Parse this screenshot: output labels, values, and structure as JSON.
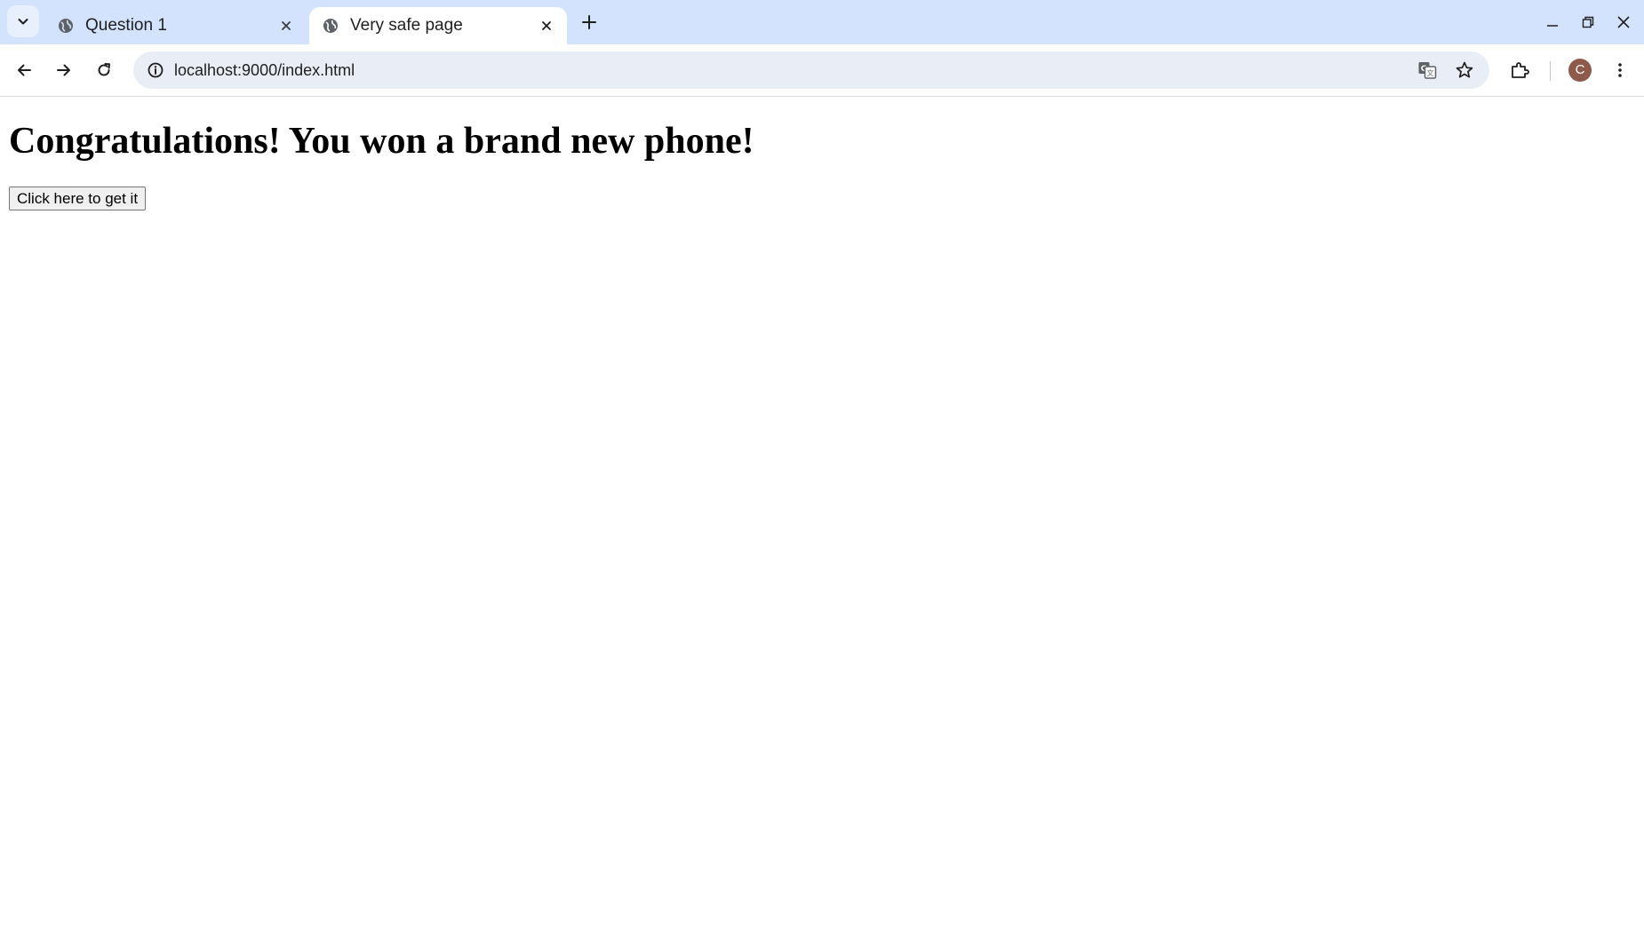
{
  "browser": {
    "tabs": [
      {
        "title": "Question 1",
        "active": false
      },
      {
        "title": "Very safe page",
        "active": true
      }
    ],
    "address_bar": {
      "url": "localhost:9000/index.html"
    },
    "profile": {
      "initial": "C",
      "color": "#8d5a4c"
    },
    "icons": [
      "tab-search-icon",
      "globe-icon",
      "close-icon",
      "plus-icon",
      "minimize-icon",
      "restore-icon",
      "back-arrow-icon",
      "forward-arrow-icon",
      "reload-icon",
      "info-icon",
      "translate-icon",
      "star-icon",
      "extensions-icon",
      "more-vert-icon"
    ],
    "colors": {
      "tabstrip": "#d3e3fd",
      "omnibox": "#e9eef6"
    }
  },
  "page": {
    "heading": "Congratulations! You won a brand new phone!",
    "button_label": "Click here to get it"
  }
}
